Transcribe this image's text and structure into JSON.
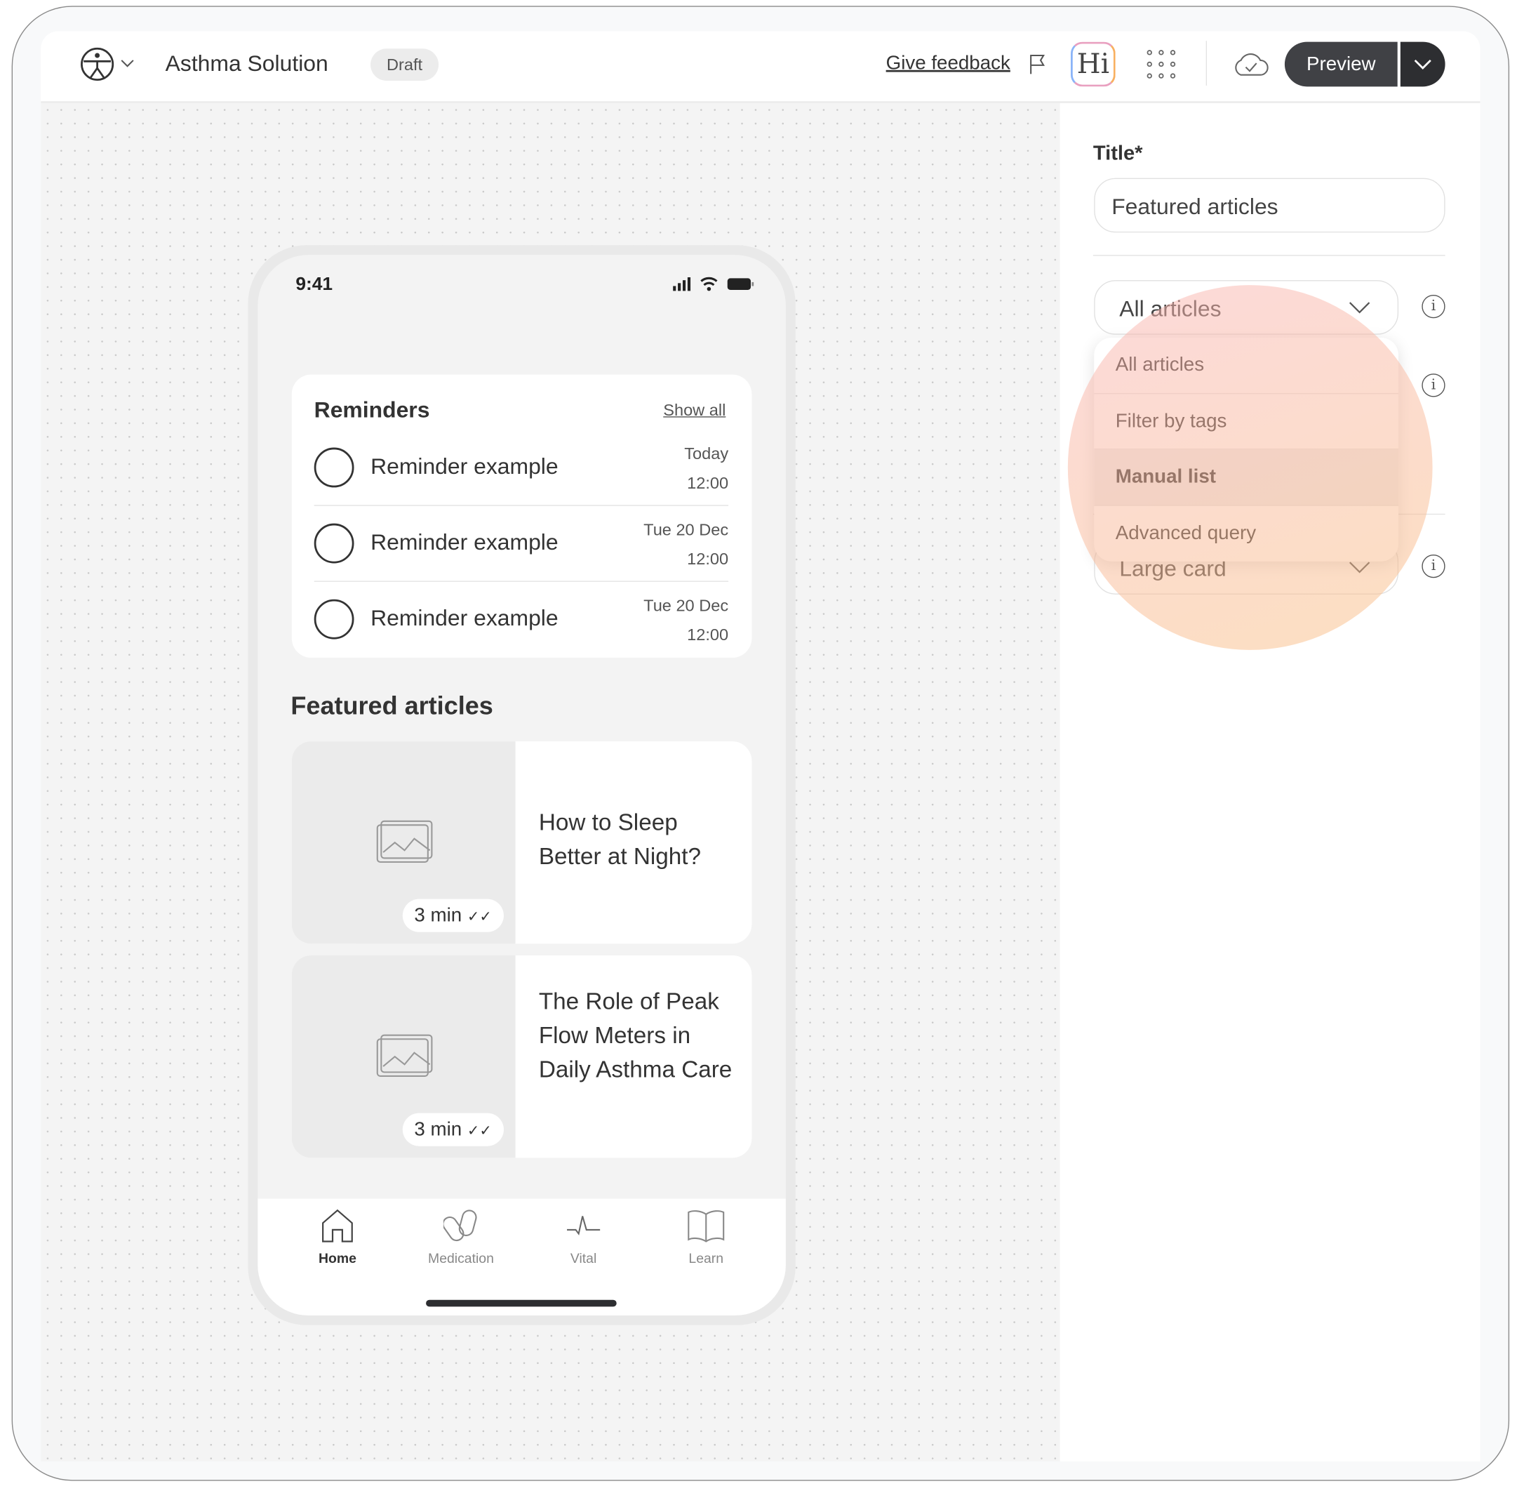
{
  "header": {
    "app_name": "Asthma Solution",
    "status_badge": "Draft",
    "feedback_label": "Give feedback",
    "hi_label": "Hi",
    "preview_label": "Preview"
  },
  "phone": {
    "time": "9:41",
    "reminders": {
      "title": "Reminders",
      "show_all": "Show all",
      "items": [
        {
          "label": "Reminder example",
          "date": "Today",
          "time": "12:00"
        },
        {
          "label": "Reminder example",
          "date": "Tue 20 Dec",
          "time": "12:00"
        },
        {
          "label": "Reminder example",
          "date": "Tue 20 Dec",
          "time": "12:00"
        }
      ]
    },
    "featured": {
      "title": "Featured articles",
      "articles": [
        {
          "title": "How to Sleep Better at Night?",
          "duration": "3 min"
        },
        {
          "title": "The Role of Peak Flow Meters in Daily Asthma Care",
          "duration": "3 min"
        }
      ]
    },
    "nav": [
      {
        "label": "Home",
        "active": true
      },
      {
        "label": "Medication"
      },
      {
        "label": "Vital"
      },
      {
        "label": "Learn"
      }
    ]
  },
  "panel": {
    "title_label": "Title*",
    "title_value": "Featured articles",
    "source_select": "All articles",
    "source_options": [
      "All articles",
      "Filter by tags",
      "Manual list",
      "Advanced query"
    ],
    "highlighted_option": "Manual list",
    "layout_select": "Large card"
  },
  "colors": {
    "preview_bg": "#404145",
    "highlight": "#f6b8a8"
  }
}
